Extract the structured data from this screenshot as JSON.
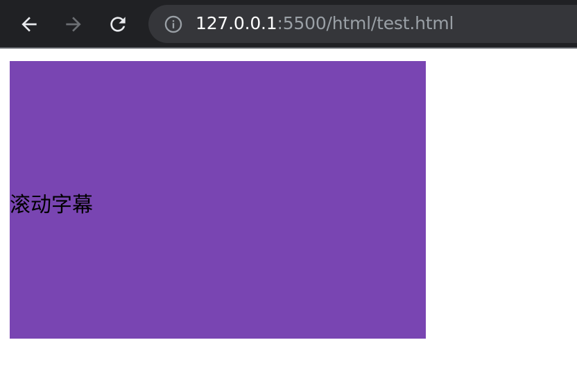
{
  "browser": {
    "address_bar": {
      "host": "127.0.0.1",
      "path": ":5500/html/test.html"
    },
    "icons": {
      "back": "back-arrow-icon",
      "forward": "forward-arrow-icon",
      "reload": "reload-icon",
      "site_info": "info-icon"
    },
    "colors": {
      "toolbar": "#202124",
      "omnibox": "#35363a",
      "host_text": "#ffffff",
      "path_text": "#9aa0a6"
    }
  },
  "page": {
    "marquee": {
      "text": "滚动字幕",
      "background": "#7945b2"
    }
  }
}
